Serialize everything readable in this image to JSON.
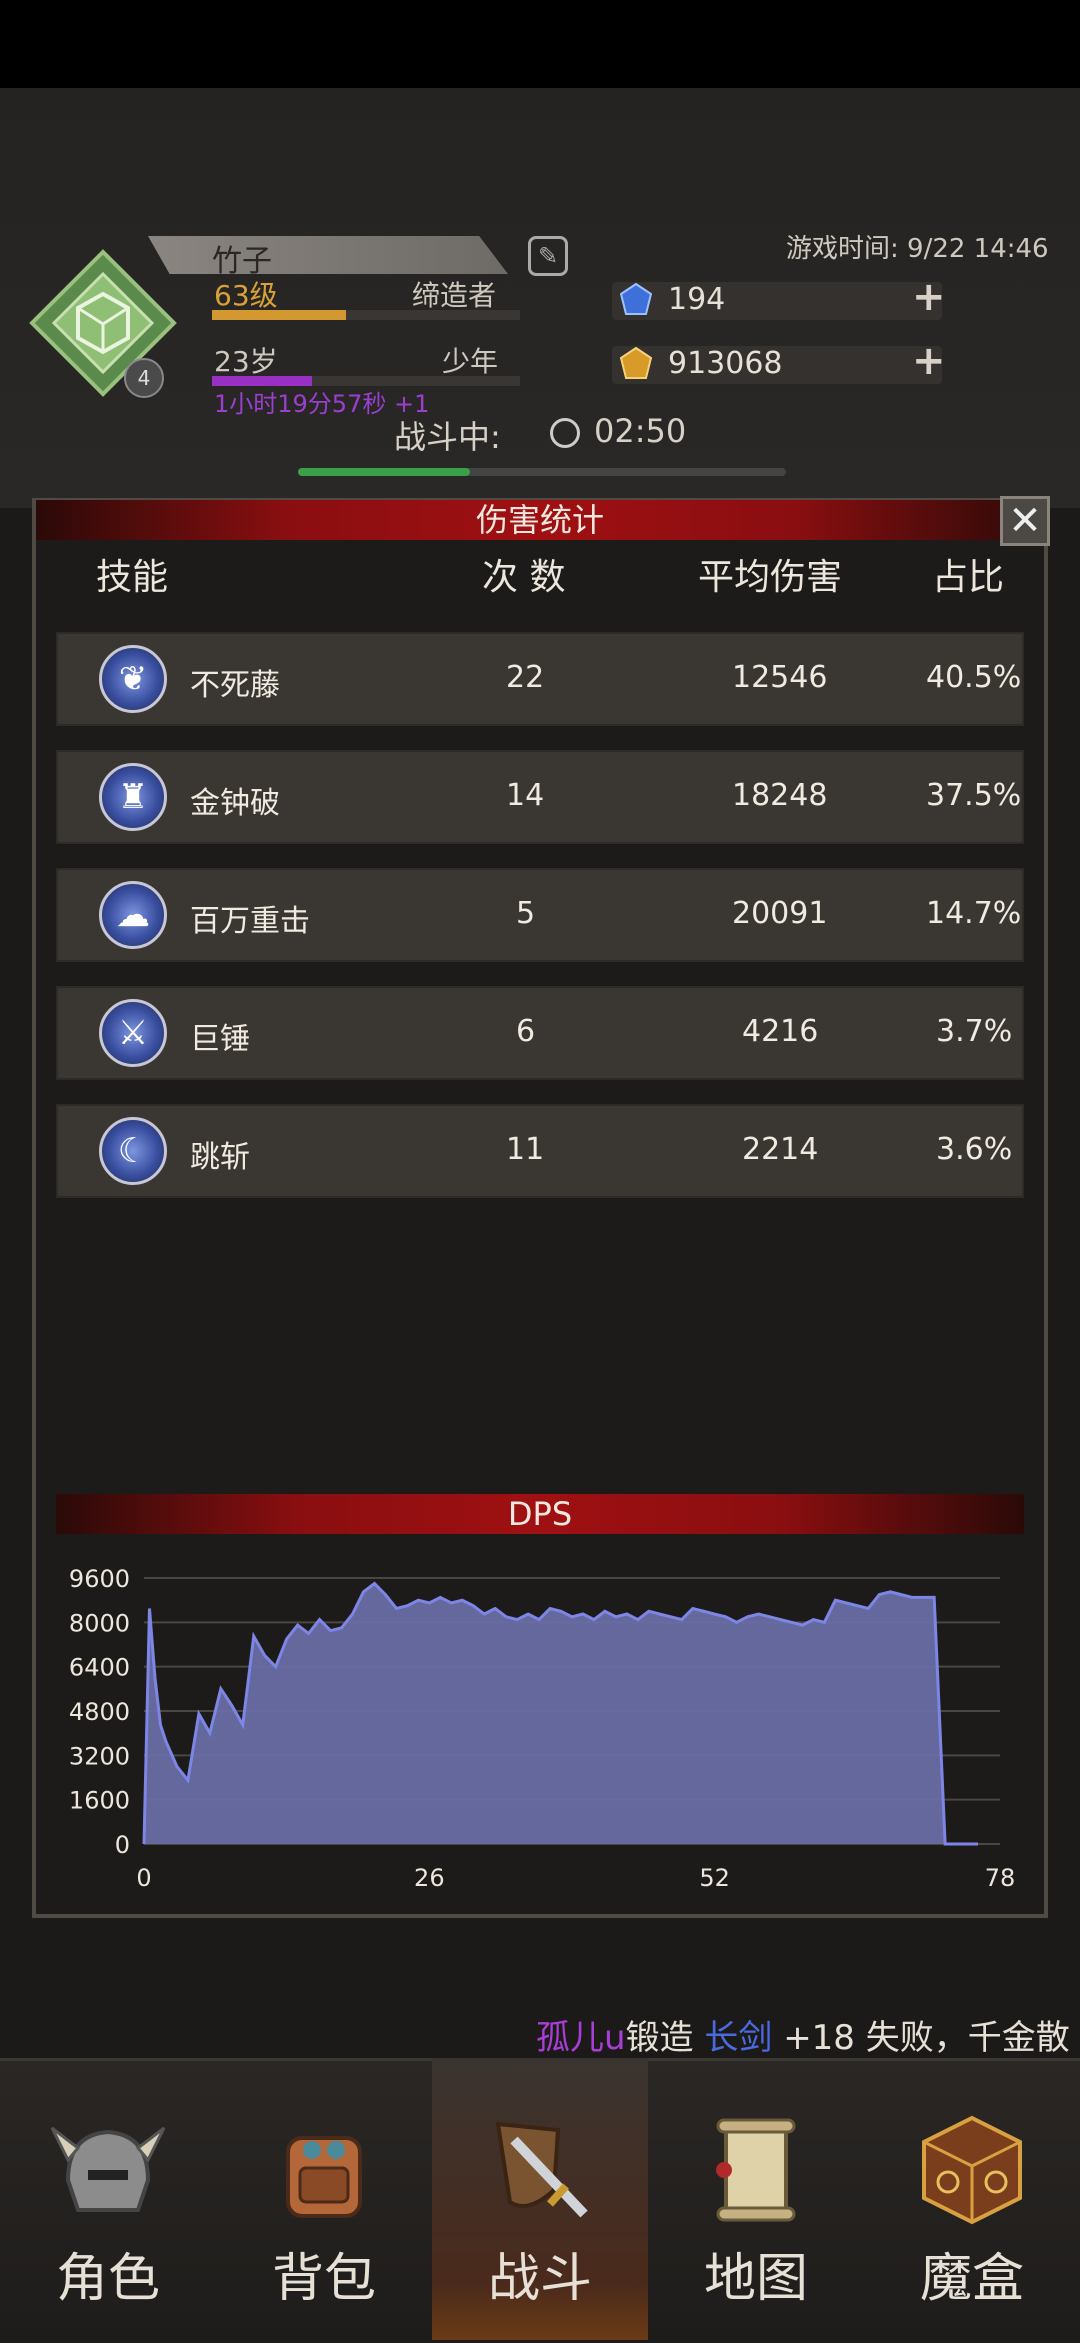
{
  "header": {
    "player_name": "竹子",
    "level": "63级",
    "title": "缔造者",
    "age": "23岁",
    "age_class": "少年",
    "age_timer": "1小时19分57秒 +1",
    "badge_number": "4",
    "game_time": "游戏时间: 9/22 14:46",
    "diamonds": "194",
    "gold": "913068",
    "battle_label": "战斗中:",
    "battle_timer": "02:50"
  },
  "dialog": {
    "title": "伤害统计",
    "columns": [
      "技能",
      "次 数",
      "平均伤害",
      "占比"
    ],
    "rows": [
      {
        "skill": "不死藤",
        "count": "22",
        "avg": "12546",
        "share": "40.5%"
      },
      {
        "skill": "金钟破",
        "count": "14",
        "avg": "18248",
        "share": "37.5%"
      },
      {
        "skill": "百万重击",
        "count": "5",
        "avg": "20091",
        "share": "14.7%"
      },
      {
        "skill": "巨锤",
        "count": "6",
        "avg": "4216",
        "share": "3.7%"
      },
      {
        "skill": "跳斩",
        "count": "11",
        "avg": "2214",
        "share": "3.6%"
      }
    ],
    "close_label": "✕"
  },
  "chart_data": {
    "type": "area",
    "title": "DPS",
    "xlabel": "",
    "ylabel": "",
    "xlim": [
      0,
      78
    ],
    "ylim": [
      0,
      9600
    ],
    "xticks": [
      "0",
      "26",
      "52",
      "78"
    ],
    "yticks": [
      "9600",
      "8000",
      "6400",
      "4800",
      "3200",
      "1600",
      "0"
    ],
    "grid": true,
    "series": [
      {
        "x": [
          0,
          0.5,
          1,
          1.5,
          2,
          3,
          4,
          5,
          6,
          7,
          8,
          9,
          10,
          11,
          12,
          13,
          14,
          15,
          16,
          17,
          18,
          19,
          20,
          21,
          22,
          23,
          24,
          25,
          26,
          27,
          28,
          29,
          30,
          31,
          32,
          33,
          34,
          35,
          36,
          37,
          38,
          39,
          40,
          41,
          42,
          43,
          44,
          45,
          46,
          47,
          48,
          49,
          50,
          51,
          52,
          53,
          54,
          55,
          56,
          57,
          58,
          59,
          60,
          61,
          62,
          63,
          64,
          65,
          66,
          67,
          68,
          69,
          70,
          71,
          72,
          73,
          74,
          75,
          76
        ],
        "values": [
          0,
          8500,
          6000,
          4300,
          3700,
          2800,
          2300,
          4700,
          4000,
          5600,
          5000,
          4300,
          7500,
          6800,
          6400,
          7400,
          7900,
          7600,
          8100,
          7700,
          7800,
          8300,
          9100,
          9400,
          9000,
          8500,
          8600,
          8800,
          8700,
          8900,
          8700,
          8800,
          8600,
          8300,
          8500,
          8200,
          8100,
          8300,
          8100,
          8500,
          8400,
          8200,
          8300,
          8100,
          8400,
          8200,
          8300,
          8100,
          8400,
          8300,
          8200,
          8100,
          8500,
          8400,
          8300,
          8200,
          8000,
          8200,
          8300,
          8200,
          8100,
          8000,
          7900,
          8100,
          8000,
          8800,
          8700,
          8600,
          8500,
          9000,
          9100,
          9000,
          8900,
          8900,
          8900,
          0,
          0,
          0,
          0
        ],
        "color": "#6a6fa8"
      }
    ]
  },
  "ticker": {
    "player": "孤儿u",
    "action": "锻造",
    "item": "长剑",
    "rest": "+18 失败，千金散"
  },
  "tabs": [
    {
      "label": "角色",
      "icon": "helmet-icon"
    },
    {
      "label": "背包",
      "icon": "backpack-icon"
    },
    {
      "label": "战斗",
      "icon": "sword-shield-icon"
    },
    {
      "label": "地图",
      "icon": "scroll-map-icon"
    },
    {
      "label": "魔盒",
      "icon": "magic-box-icon"
    }
  ],
  "colors": {
    "accent_red": "#a01012",
    "gold_text": "#d8a238",
    "purple_text": "#9a3fd0",
    "chart_fill": "#6a6fa8",
    "chart_line": "#7d86e6"
  }
}
